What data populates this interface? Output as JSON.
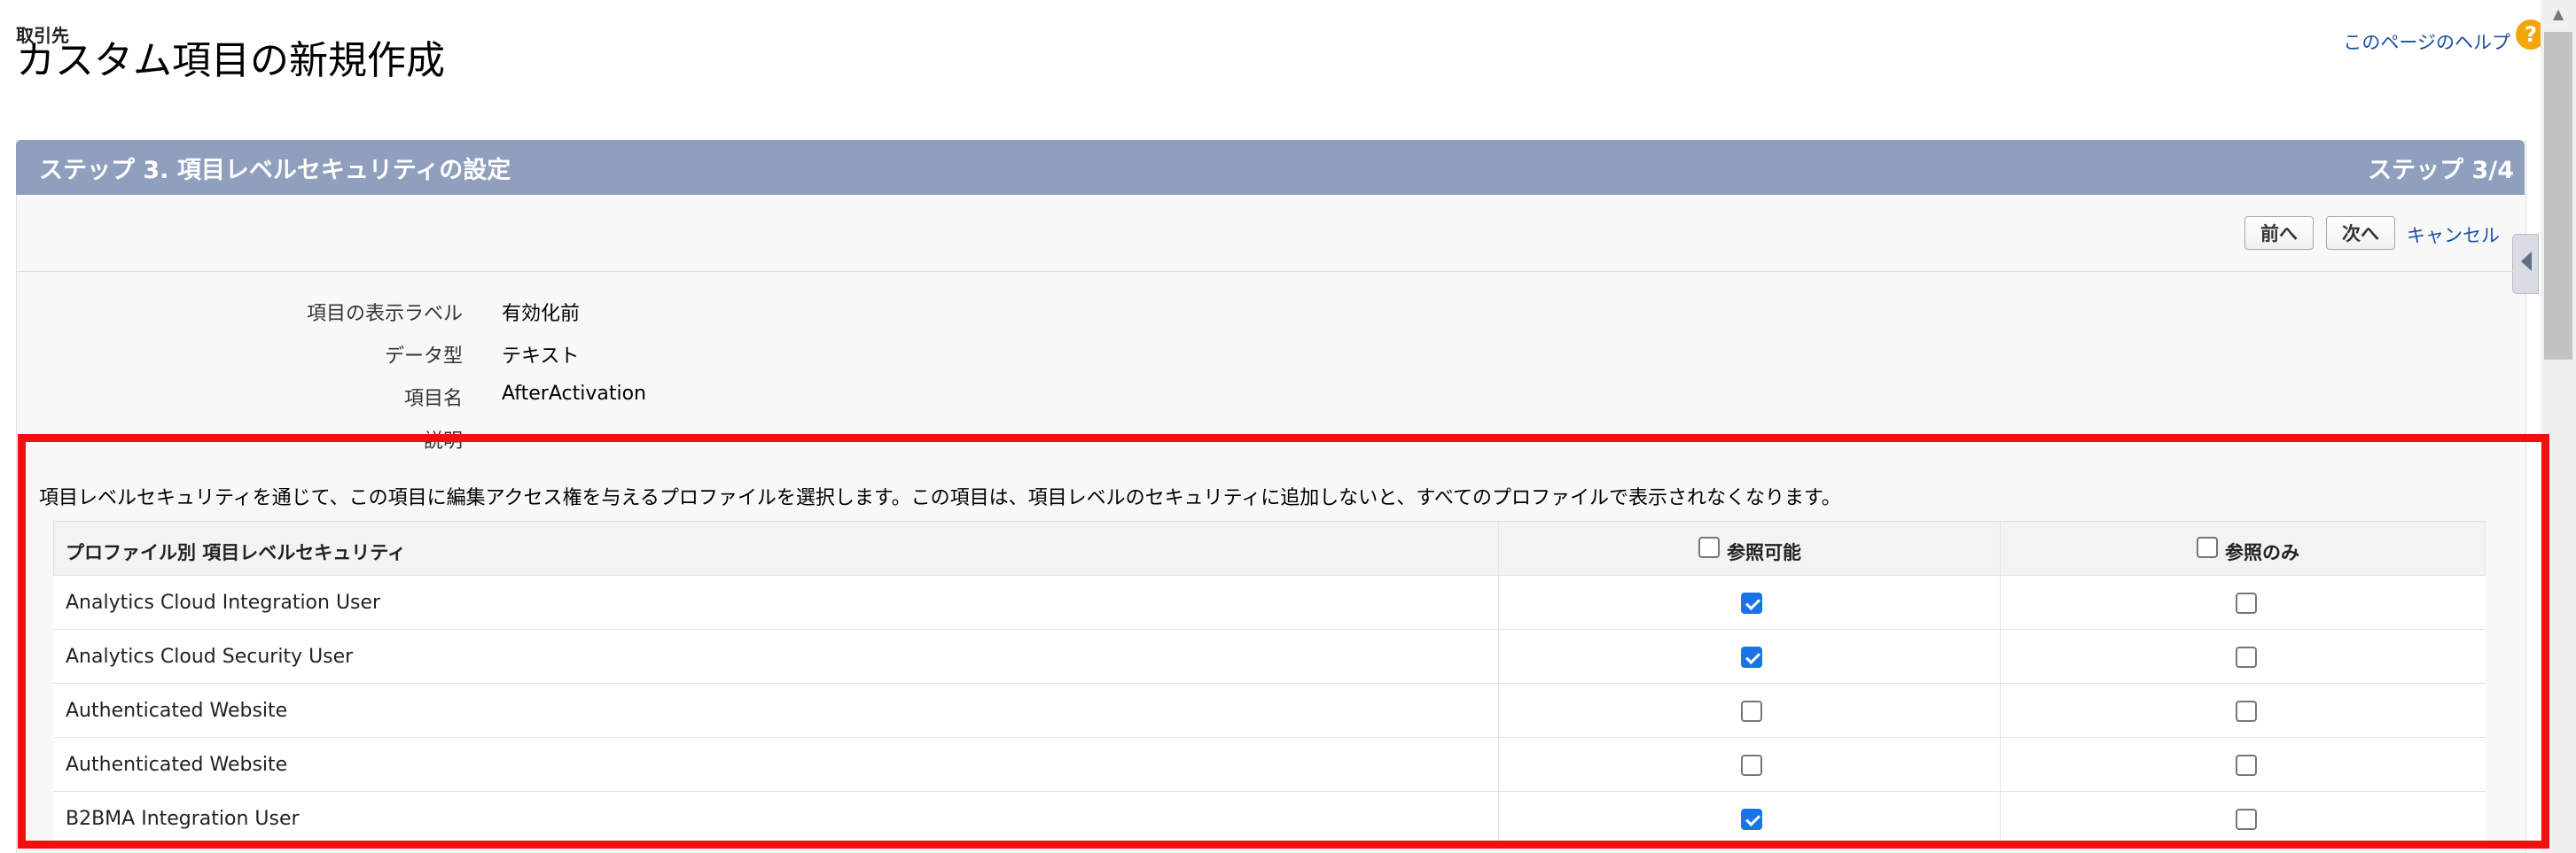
{
  "header": {
    "object_label": "取引先",
    "title": "カスタム項目の新規作成",
    "help_link": "このページのヘルプ",
    "help_icon": "question-icon"
  },
  "step": {
    "title": "ステップ 3. 項目レベルセキュリティの設定",
    "indicator": "ステップ 3/4",
    "buttons": {
      "prev": "前へ",
      "next": "次へ",
      "cancel": "キャンセル"
    }
  },
  "field_details": [
    {
      "label": "項目の表示ラベル",
      "value": "有効化前"
    },
    {
      "label": "データ型",
      "value": "テキスト"
    },
    {
      "label": "項目名",
      "value": "AfterActivation"
    },
    {
      "label": "説明",
      "value": ""
    }
  ],
  "security": {
    "description": "項目レベルセキュリティを通じて、この項目に編集アクセス権を与えるプロファイルを選択します。この項目は、項目レベルのセキュリティに追加しないと、すべてのプロファイルで表示されなくなります。",
    "columns": {
      "profile": "プロファイル別 項目レベルセキュリティ",
      "visible": "参照可能",
      "readonly": "参照のみ"
    },
    "header_visible_checked": false,
    "header_readonly_checked": false,
    "rows": [
      {
        "profile": "Analytics Cloud Integration User",
        "visible": true,
        "readonly": false
      },
      {
        "profile": "Analytics Cloud Security User",
        "visible": true,
        "readonly": false
      },
      {
        "profile": "Authenticated Website",
        "visible": false,
        "readonly": false
      },
      {
        "profile": "Authenticated Website",
        "visible": false,
        "readonly": false
      },
      {
        "profile": "B2BMA Integration User",
        "visible": true,
        "readonly": false
      }
    ]
  },
  "colors": {
    "panel_header": "#8f9fbd",
    "highlight": "#f01010",
    "link": "#1a4fa3",
    "checkbox_checked": "#1a73e8",
    "help_icon": "#f2a60c"
  }
}
